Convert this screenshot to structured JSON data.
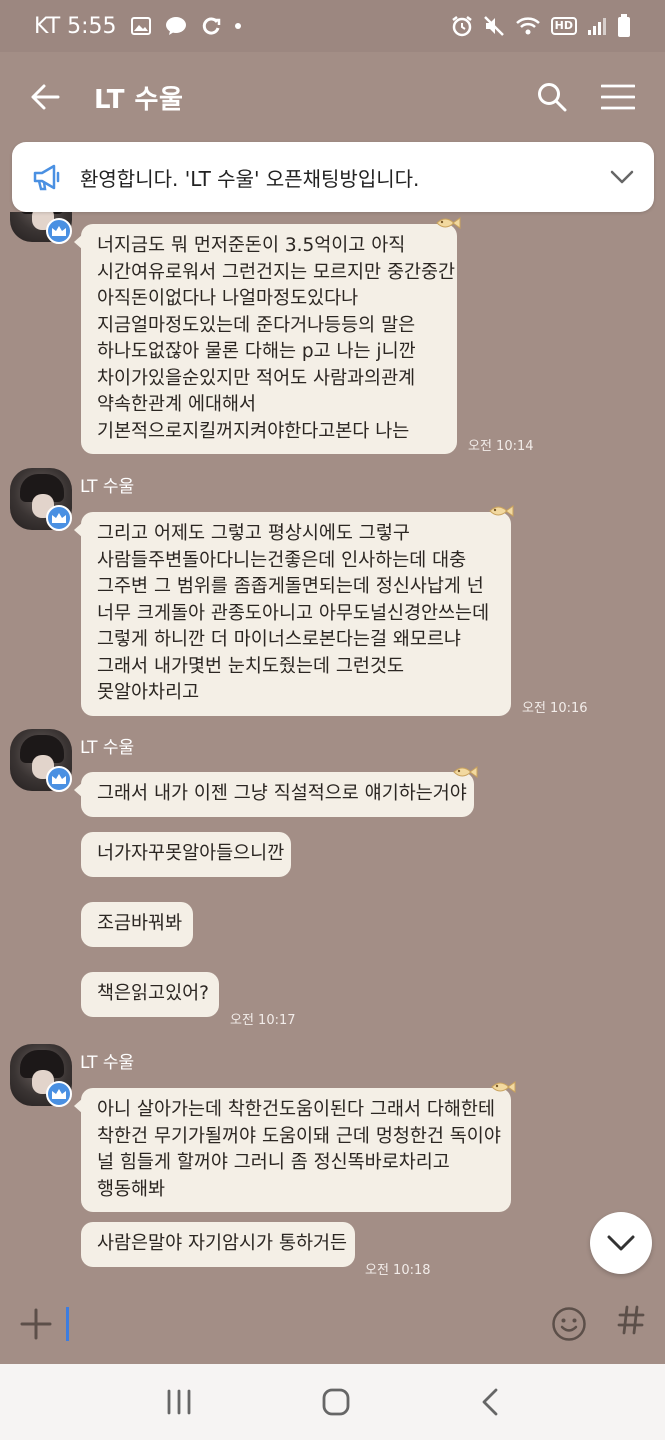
{
  "status_bar": {
    "carrier_time": "KT 5:55",
    "hd_label": "HD"
  },
  "header": {
    "title": "LT 수울"
  },
  "notice": {
    "text": "환영합니다. 'LT 수울' 오픈채팅방입니다."
  },
  "messages": {
    "group1": {
      "bubble1": "너지금도 뭐 먼저준돈이 3.5억이고 아직\n시간여유로워서 그런건지는 모르지만 중간중간\n아직돈이없다나 나얼마정도있다나\n지금얼마정도있는데 준다거나등등의 말은\n하나도없잖아 물론 다해는 p고 나는 j니깐\n차이가있을순있지만 적어도 사람과의관계\n약속한관계 에대해서\n기본적으로지킬꺼지켜야한다고본다 나는",
      "time": "오전 10:14"
    },
    "group2": {
      "sender": "LT 수울",
      "bubble1": "그리고 어제도 그렇고 평상시에도 그렇구\n사람들주변돌아다니는건좋은데 인사하는데 대충\n그주변 그 범위를 좀좁게돌면되는데 정신사납게 넌\n너무 크게돌아 관종도아니고 아무도널신경안쓰는데\n그렇게 하니깐 더 마이너스로본다는걸 왜모르냐\n그래서 내가몇번 눈치도줬는데 그런것도\n못알아차리고",
      "time": "오전 10:16"
    },
    "group3": {
      "sender": "LT 수울",
      "bubble1": "그래서 내가 이젠 그냥 직설적으로 얘기하는거야",
      "bubble2": "너가자꾸못알아들으니깐",
      "bubble3": "조금바꿔봐",
      "bubble4": "책은읽고있어?",
      "time": "오전 10:17"
    },
    "group4": {
      "sender": "LT 수울",
      "bubble1": "아니 살아가는데 착한건도움이된다 그래서 다해한테\n착한건 무기가될꺼야 도움이돼 근데 멍청한건 독이야\n널 힘들게 할꺼야 그러니 좀 정신똑바로차리고\n행동해봐",
      "bubble2": "사람은말야 자기암시가 통하거든",
      "time": "오전 10:18"
    }
  },
  "input": {
    "value": ""
  },
  "colors": {
    "background": "#a38e86",
    "bubble": "#f4efe6",
    "accent_blue": "#4a90e2",
    "caret": "#3d7de0"
  },
  "icons": {
    "back": "arrow-left-icon",
    "search": "search-icon",
    "menu": "menu-icon",
    "notice": "megaphone-icon",
    "expand": "chevron-down-icon",
    "badge": "crown-icon",
    "react": "fish-icon",
    "scroll": "chevron-down-icon",
    "attach": "plus-icon",
    "emoji": "smiley-icon",
    "hashtag": "hash-icon"
  }
}
